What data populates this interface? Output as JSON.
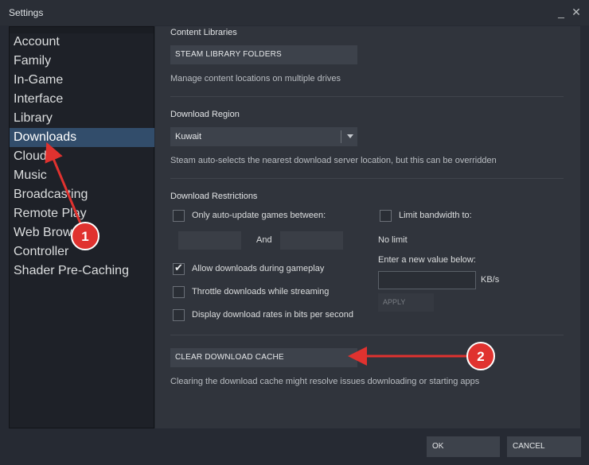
{
  "window": {
    "title": "Settings"
  },
  "sidebar": {
    "items": [
      {
        "label": "Account",
        "active": false
      },
      {
        "label": "Family",
        "active": false
      },
      {
        "label": "In-Game",
        "active": false
      },
      {
        "label": "Interface",
        "active": false
      },
      {
        "label": "Library",
        "active": false
      },
      {
        "label": "Downloads",
        "active": true
      },
      {
        "label": "Cloud",
        "active": false
      },
      {
        "label": "Music",
        "active": false
      },
      {
        "label": "Broadcasting",
        "active": false
      },
      {
        "label": "Remote Play",
        "active": false
      },
      {
        "label": "Web Browser",
        "active": false
      },
      {
        "label": "Controller",
        "active": false
      },
      {
        "label": "Shader Pre-Caching",
        "active": false
      }
    ]
  },
  "content_libraries": {
    "title": "Content Libraries",
    "button": "STEAM LIBRARY FOLDERS",
    "description": "Manage content locations on multiple drives"
  },
  "download_region": {
    "title": "Download Region",
    "selected": "Kuwait",
    "description": "Steam auto-selects the nearest download server location, but this can be overridden"
  },
  "download_restrictions": {
    "title": "Download Restrictions",
    "auto_update_label": "Only auto-update games between:",
    "auto_update_checked": false,
    "and_label": "And",
    "allow_during_gameplay_label": "Allow downloads during gameplay",
    "allow_during_gameplay_checked": true,
    "throttle_label": "Throttle downloads while streaming",
    "throttle_checked": false,
    "bits_label": "Display download rates in bits per second",
    "bits_checked": false,
    "limit_bandwidth_label": "Limit bandwidth to:",
    "limit_bandwidth_checked": false,
    "no_limit_text": "No limit",
    "enter_value_label": "Enter a new value below:",
    "unit": "KB/s",
    "apply_label": "APPLY"
  },
  "cache": {
    "button": "CLEAR DOWNLOAD CACHE",
    "description": "Clearing the download cache might resolve issues downloading or starting apps"
  },
  "footer": {
    "ok": "OK",
    "cancel": "CANCEL"
  },
  "annotations": {
    "badge_1": "1",
    "badge_2": "2"
  },
  "colors": {
    "accent": "#324d6b",
    "annotation_red": "#e0322f",
    "background": "#30343c"
  }
}
